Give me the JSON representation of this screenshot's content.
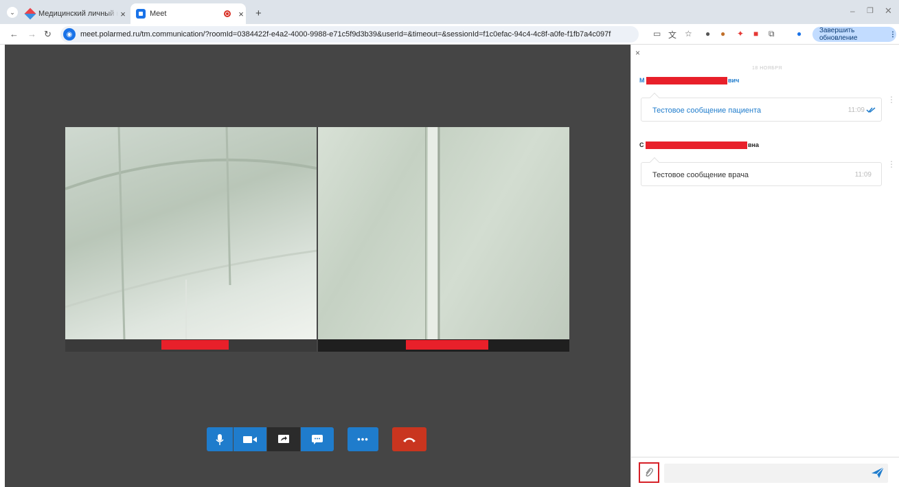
{
  "browser": {
    "tab1_title": "Медицинский личный кабинет",
    "tab2_title": "Meet",
    "url": "meet.polarmed.ru/tm.communication/?roomId=0384422f-e4a2-4000-9988-e71c5f9d3b39&userId=&timeout=&sessionId=f1c0efac-94c4-4c8f-a0fe-f1fb7a4c097f",
    "update_button": "Завершить обновление"
  },
  "chat": {
    "date_label": "18 НОЯБРЯ",
    "messages": [
      {
        "author_start": "М",
        "author_end": "вич",
        "text": "Тестовое сообщение пациента",
        "time": "11:09"
      },
      {
        "author_start": "С",
        "author_end": "вна",
        "text": "Тестовое сообщение врача",
        "time": "11:09"
      }
    ]
  },
  "colors": {
    "accent": "#1f7ccc",
    "hangup": "#c9351f",
    "redaction": "#e8202a",
    "stage": "#454545"
  }
}
